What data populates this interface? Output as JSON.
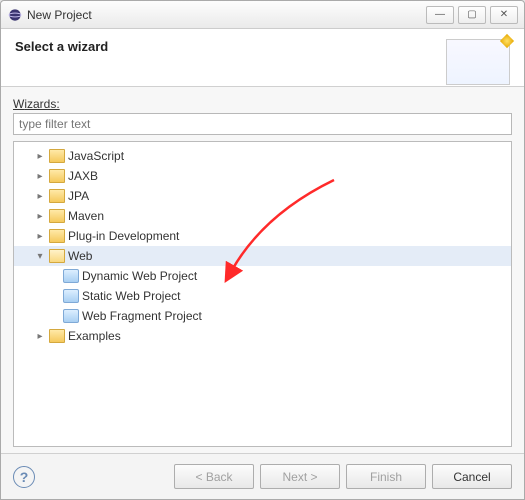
{
  "titlebar": {
    "title": "New Project"
  },
  "banner": {
    "heading": "Select a wizard"
  },
  "wizards": {
    "label_prefix": "W",
    "label_rest": "izards:",
    "filter_placeholder": "type filter text"
  },
  "tree": [
    {
      "id": "javascript",
      "label": "JavaScript",
      "depth": 1,
      "leaf": false,
      "expanded": false,
      "icon": "folder"
    },
    {
      "id": "jaxb",
      "label": "JAXB",
      "depth": 1,
      "leaf": false,
      "expanded": false,
      "icon": "folder"
    },
    {
      "id": "jpa",
      "label": "JPA",
      "depth": 1,
      "leaf": false,
      "expanded": false,
      "icon": "folder"
    },
    {
      "id": "maven",
      "label": "Maven",
      "depth": 1,
      "leaf": false,
      "expanded": false,
      "icon": "folder"
    },
    {
      "id": "plugin-dev",
      "label": "Plug-in Development",
      "depth": 1,
      "leaf": false,
      "expanded": false,
      "icon": "folder"
    },
    {
      "id": "web",
      "label": "Web",
      "depth": 1,
      "leaf": false,
      "expanded": true,
      "icon": "folder-open",
      "selected": true
    },
    {
      "id": "dwp",
      "label": "Dynamic Web Project",
      "depth": 2,
      "leaf": true,
      "icon": "wiz"
    },
    {
      "id": "swp",
      "label": "Static Web Project",
      "depth": 2,
      "leaf": true,
      "icon": "wiz"
    },
    {
      "id": "wfp",
      "label": "Web Fragment Project",
      "depth": 2,
      "leaf": true,
      "icon": "wiz"
    },
    {
      "id": "examples",
      "label": "Examples",
      "depth": 1,
      "leaf": false,
      "expanded": false,
      "icon": "folder"
    }
  ],
  "buttons": {
    "back": "< Back",
    "next": "Next >",
    "finish": "Finish",
    "cancel": "Cancel"
  },
  "help_tooltip": "Help"
}
